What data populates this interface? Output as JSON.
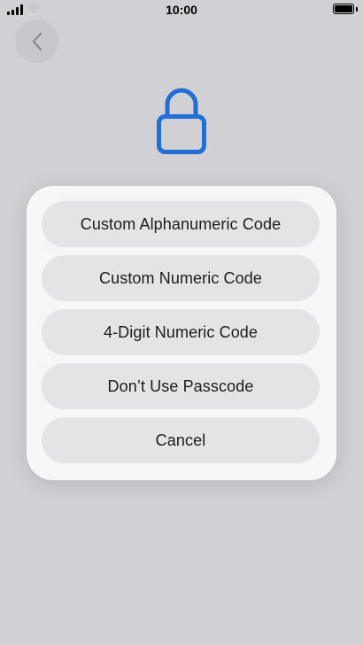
{
  "status_bar": {
    "time": "10:00"
  },
  "action_sheet": {
    "options": [
      {
        "label": "Custom Alphanumeric Code"
      },
      {
        "label": "Custom Numeric Code"
      },
      {
        "label": "4-Digit Numeric Code"
      },
      {
        "label": "Don’t Use Passcode"
      },
      {
        "label": "Cancel"
      }
    ]
  },
  "icons": {
    "back": "chevron-left-icon",
    "lock": "lock-icon",
    "lock_color": "#1f6fd6"
  }
}
